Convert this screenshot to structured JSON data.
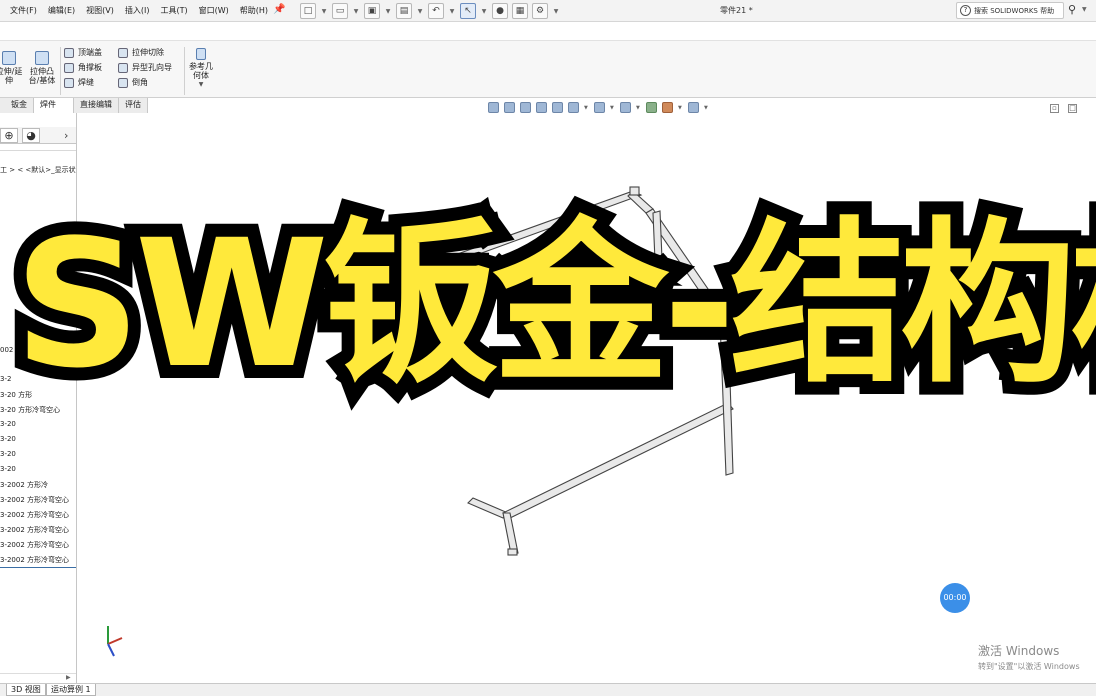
{
  "menubar": {
    "items": [
      "文件(F)",
      "编辑(E)",
      "视图(V)",
      "插入(I)",
      "工具(T)",
      "窗口(W)",
      "帮助(H)"
    ],
    "document_title": "零件21 *",
    "search_label": "搜索 SOLIDWORKS 帮助"
  },
  "command_manager": {
    "big_buttons": [
      {
        "label": "拉伸/延\n伸",
        "icon": "extrude-extend-icon"
      },
      {
        "label": "拉伸凸\n台/基体",
        "icon": "boss-extrude-icon"
      }
    ],
    "col1": [
      {
        "label": "顶端盖",
        "icon": "end-cap-icon"
      },
      {
        "label": "角撑板",
        "icon": "gusset-icon"
      },
      {
        "label": "焊缝",
        "icon": "weld-bead-icon"
      }
    ],
    "col2": [
      {
        "label": "拉伸切除",
        "icon": "extruded-cut-icon"
      },
      {
        "label": "异型孔向导",
        "icon": "hole-wizard-icon"
      },
      {
        "label": "倒角",
        "icon": "chamfer-icon"
      }
    ],
    "ref_geometry": {
      "label": "参考几\n何体",
      "icon": "reference-geometry-icon"
    }
  },
  "tabs": [
    "钣金",
    "焊件",
    "直接编辑",
    "评估"
  ],
  "active_tab": "焊件",
  "left_panel": {
    "path": "工 > < <默认>_显示状",
    "tree_items": [
      "002 方形冷",
      "3-2",
      "3-20 方形",
      "3-20 方形冷弯空心",
      "3-20",
      "3-20",
      "3-20",
      "3-20",
      "3-2002 方形冷",
      "3-2002 方形冷弯空心",
      "3-2002 方形冷弯空心",
      "3-2002 方形冷弯空心",
      "3-2002 方形冷弯空心",
      "3-2002 方形冷弯空心"
    ]
  },
  "bottom_tabs": [
    "3D 视图",
    "运动算例 1"
  ],
  "overlay_title": "SW钣金-结构构件",
  "timer": "00:00",
  "activation": {
    "line1": "激活 Windows",
    "line2": "转到\"设置\"以激活 Windows"
  },
  "colors": {
    "overlay_fill": "#ffe93b",
    "overlay_stroke": "#000000",
    "timer_bg": "#3b8fe8"
  }
}
